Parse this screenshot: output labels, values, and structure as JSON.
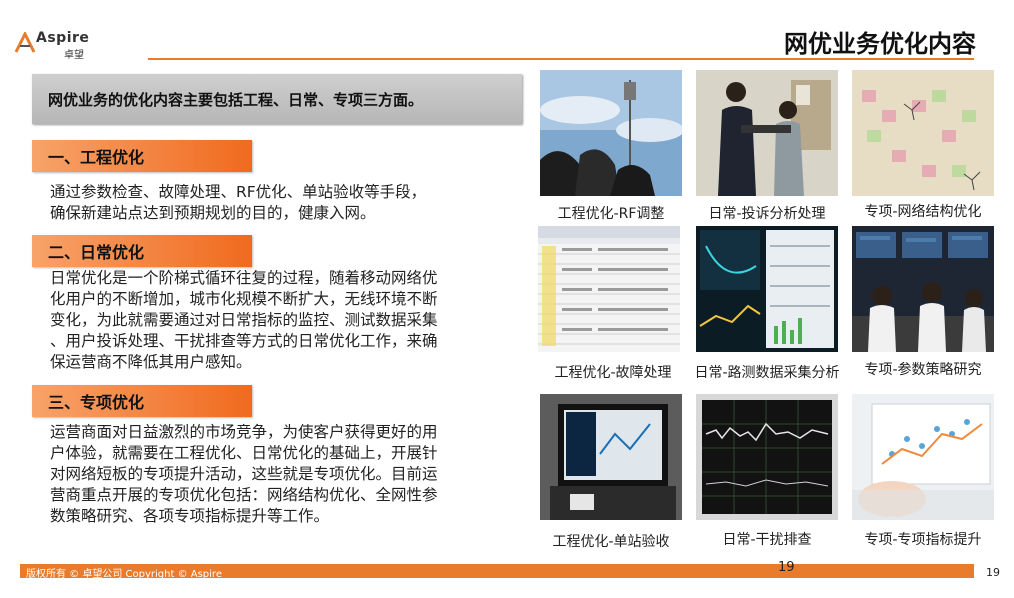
{
  "header": {
    "logo_en": "Aspire",
    "logo_cn": "卓望",
    "title": "网优业务优化内容"
  },
  "intro": "网优业务的优化内容主要包括工程、日常、专项三方面。",
  "sections": [
    {
      "heading": "一、工程优化",
      "lines": [
        "通过参数检查、故障处理、RF优化、单站验收等手段，",
        "确保新建站点达到预期规划的目的，健康入网。"
      ]
    },
    {
      "heading": "二、日常优化",
      "lines": [
        "日常优化是一个阶梯式循环往复的过程，随着移动网络优",
        "化用户的不断增加，城市化规模不断扩大，无线环境不断",
        "变化，为此就需要通过对日常指标的监控、测试数据采集",
        "、用户投诉处理、干扰排查等方式的日常优化工作，来确",
        "保运营商不降低其用户感知。"
      ]
    },
    {
      "heading": "三、专项优化",
      "lines": [
        "运营商面对日益激烈的市场竞争，为使客户获得更好的用",
        "户体验，就需要在工程优化、日常优化的基础上，开展针",
        "对网络短板的专项提升活动，这些就是专项优化。目前运",
        "营商重点开展的专项优化包括：网络结构优化、全网性参",
        "数策略研究、各项专项指标提升等工作。"
      ]
    }
  ],
  "photos": [
    {
      "caption": "工程优化-RF调整",
      "icon": "tower-photo"
    },
    {
      "caption": "日常-投诉分析处理",
      "icon": "people-photo"
    },
    {
      "caption": "专项-网络结构优化",
      "icon": "map-photo"
    },
    {
      "caption": "工程优化-故障处理",
      "icon": "spreadsheet-photo"
    },
    {
      "caption": "日常-路测数据采集分析",
      "icon": "drivetest-screen-photo"
    },
    {
      "caption": "专项-参数策略研究",
      "icon": "control-room-photo"
    },
    {
      "caption": "工程优化-单站验收",
      "icon": "laptop-photo"
    },
    {
      "caption": "日常-干扰排查",
      "icon": "spectrum-photo"
    },
    {
      "caption": "专项-专项指标提升",
      "icon": "tablet-chart-photo"
    }
  ],
  "footer": {
    "copyright": "版权所有 © 卓望公司 Copyright © Aspire",
    "center_number": "19",
    "page_number": "19"
  },
  "colors": {
    "accent": "#e87b2c",
    "section_head": "#f06a1e",
    "intro_bar": "#c0c0c0"
  }
}
